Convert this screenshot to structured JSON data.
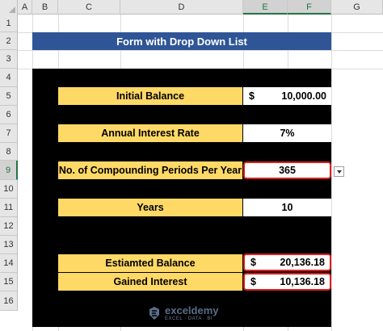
{
  "sheet": {
    "columns": [
      "A",
      "B",
      "C",
      "D",
      "E",
      "F",
      "G"
    ],
    "rows": [
      "1",
      "2",
      "3",
      "4",
      "5",
      "6",
      "7",
      "8",
      "9",
      "10",
      "11",
      "12",
      "13",
      "14",
      "15",
      "16"
    ],
    "selected_row": "9",
    "selected_columns": [
      "E",
      "F"
    ]
  },
  "form": {
    "title": "Form with Drop Down List",
    "initial_balance": {
      "label": "Initial Balance",
      "currency": "$",
      "value": "10,000.00"
    },
    "annual_interest_rate": {
      "label": "Annual Interest Rate",
      "value": "7%"
    },
    "compounding_periods": {
      "label": "No. of Compounding Periods Per Year",
      "value": "365"
    },
    "years": {
      "label": "Years",
      "value": "10"
    },
    "estimated_balance": {
      "label": "Estiamted Balance",
      "currency": "$",
      "value": "20,136.18"
    },
    "gained_interest": {
      "label": "Gained Interest",
      "currency": "$",
      "value": "10,136.18"
    }
  },
  "watermark": {
    "name": "exceldemy",
    "tagline": "EXCEL · DATA · BI"
  },
  "colors": {
    "title_bg": "#2f5597",
    "label_bg": "#ffd966",
    "panel_bg": "#000000",
    "highlight": "#e21b1b"
  }
}
